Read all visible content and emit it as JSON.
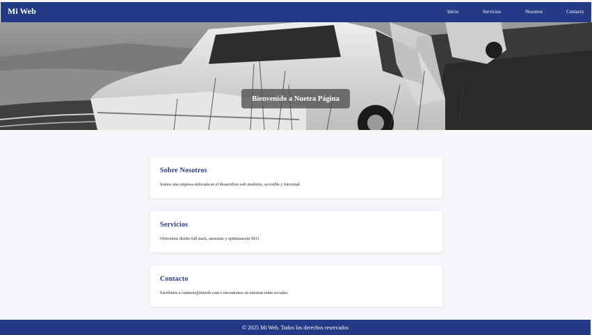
{
  "header": {
    "brand": "Mi Web",
    "nav": [
      "Inicio",
      "Servicios",
      "Nosotros",
      "Contacto"
    ]
  },
  "hero": {
    "title": "Bienvenido a Nuetra Página",
    "image": "black-and-white photo of an abandoned car in tall grass"
  },
  "sections": [
    {
      "title": "Sobre Nosotros",
      "text": "Somos una empresa enfocada en el desarrollon web moderno, accesible y funcional."
    },
    {
      "title": "Servicios",
      "text": "Ofrecemos diseño full stack, asesorias y optimizacoin SEO."
    },
    {
      "title": "Contacto",
      "text": "Escribinos a contacto@miweb.com o encontranos en nuestras redes sociales."
    }
  ],
  "footer": {
    "text": "© 2025 Mi Web. Todos los derechos reservados"
  },
  "colors": {
    "primary": "#233a86",
    "background": "#f4f6fa",
    "card": "#ffffff"
  }
}
